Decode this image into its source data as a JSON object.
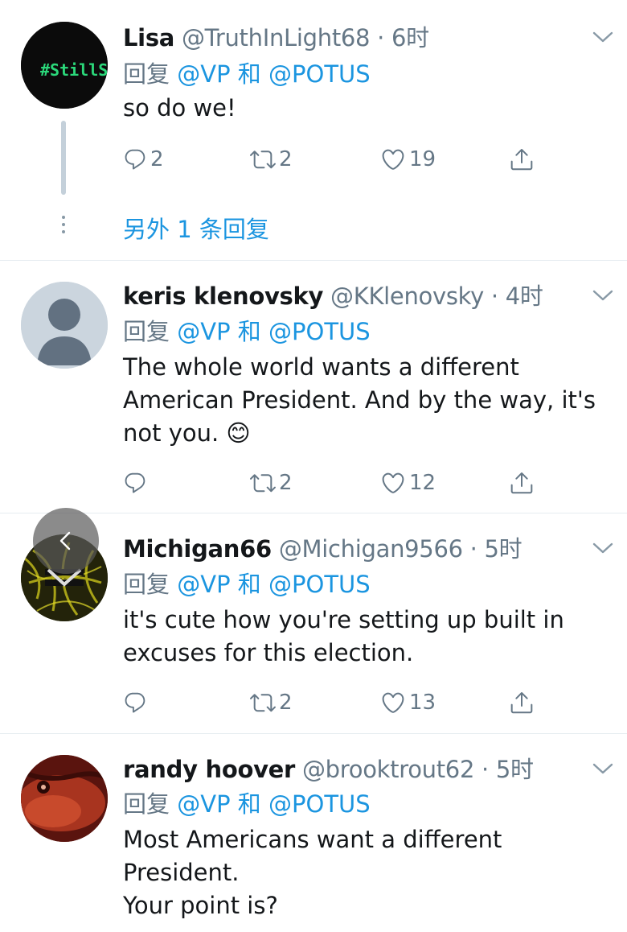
{
  "tweets": [
    {
      "name": "Lisa",
      "handle": "@TruthInLight68 · 6时",
      "reply_prefix": "回复",
      "mention1": "@VP",
      "conj": "和",
      "mention2": "@POTUS",
      "text": "so do we!",
      "avatar_text": "#StillS",
      "replies": "2",
      "retweets": "2",
      "likes": "19"
    },
    {
      "name": "keris klenovsky",
      "handle": "@KKlenovsky · 4时",
      "reply_prefix": "回复",
      "mention1": "@VP",
      "conj": "和",
      "mention2": "@POTUS",
      "text": "The whole world wants a different American President. And by the way, it's not you. 😊",
      "replies": "",
      "retweets": "2",
      "likes": "12"
    },
    {
      "name": "Michigan66",
      "handle": "@Michigan9566 · 5时",
      "reply_prefix": "回复",
      "mention1": "@VP",
      "conj": "和",
      "mention2": "@POTUS",
      "text": "it's cute how you're setting up built in excuses for this election.",
      "replies": "",
      "retweets": "2",
      "likes": "13"
    },
    {
      "name": "randy hoover",
      "handle": "@brooktrout62 · 5时",
      "reply_prefix": "回复",
      "mention1": "@VP",
      "conj": "和",
      "mention2": "@POTUS",
      "text_lines": [
        "Most Americans want a different",
        "President.",
        "Your point is?"
      ]
    }
  ],
  "more_replies": "另外 1 条回复",
  "colors": {
    "link": "#1b95e0",
    "secondary": "#657786",
    "divider": "#e6ecf0"
  },
  "icons": [
    "reply-icon",
    "retweet-icon",
    "like-icon",
    "share-icon",
    "chevron-down-icon",
    "back-arrow-icon"
  ]
}
